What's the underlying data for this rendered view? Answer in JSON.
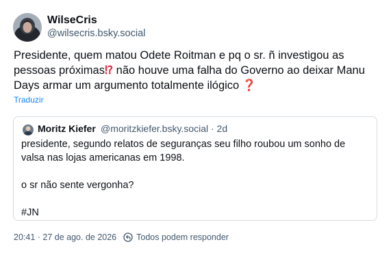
{
  "post": {
    "author": {
      "display_name": "WilseCris",
      "handle": "@wilsecris.bsky.social"
    },
    "text_lines": [
      "Presidente, quem matou Odete Roitman e pq o sr. ñ investigou as",
      [
        "pessoas próximas",
        "⁉",
        " não houve uma falha do Governo ao deixar Manu"
      ],
      [
        "Days armar um argumento totalmente ilógico",
        "❓"
      ]
    ],
    "translate_label": "Traduzir",
    "quote": {
      "author_name": "Moritz Kiefer",
      "handle_time": "@moritzkiefer.bsky.social · 2d",
      "lines": [
        "presidente, segundo relatos de seguranças seu filho roubou um sonho de",
        "valsa nas lojas americanas em 1998.",
        "",
        "o sr não sente vergonha?",
        "",
        "#JN"
      ]
    },
    "timestamp": "20:41 · 27 de ago. de 2026",
    "reply_setting": "Todos podem responder"
  },
  "icons": {
    "reply_setting": "everyone-reply-icon"
  },
  "colors": {
    "text": "#0b0f14",
    "secondary": "#42576c",
    "link": "#1083fe",
    "emoji_red": "#dd2e44",
    "border": "#d4dbe2"
  }
}
